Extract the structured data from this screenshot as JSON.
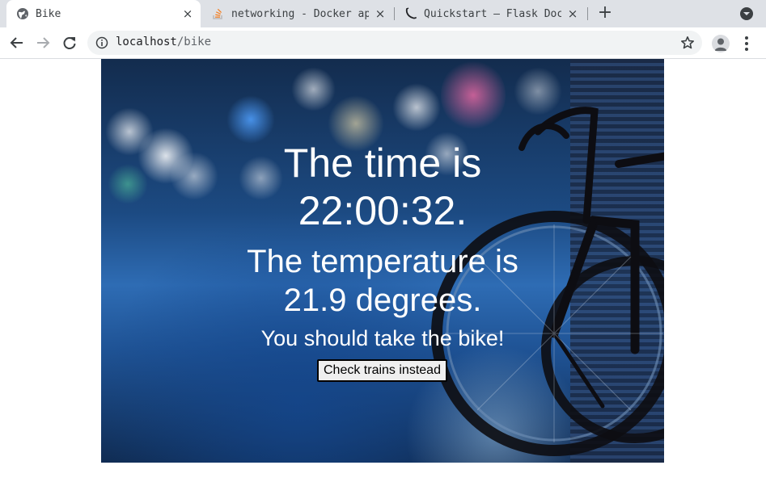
{
  "browser": {
    "tabs": [
      {
        "title": "Bike",
        "favicon": "globe-icon",
        "active": true
      },
      {
        "title": "networking - Docker ap",
        "favicon": "stackoverflow-icon",
        "active": false
      },
      {
        "title": "Quickstart — Flask Doc",
        "favicon": "flask-icon",
        "active": false
      }
    ],
    "new_tab_label": "+",
    "close_label": "×",
    "url": {
      "host": "localhost",
      "path": "/bike"
    }
  },
  "page": {
    "time_line1": "The time is",
    "time_line2": "22:00:32.",
    "temp_line1": "The temperature is",
    "temp_line2": "21.9 degrees.",
    "advice": "You should take the bike!",
    "button_label": "Check trains instead"
  },
  "colors": {
    "tabstrip": "#dee1e6",
    "omnibox": "#f1f3f4",
    "hero_text": "#ffffff",
    "button_bg": "#efefef"
  }
}
